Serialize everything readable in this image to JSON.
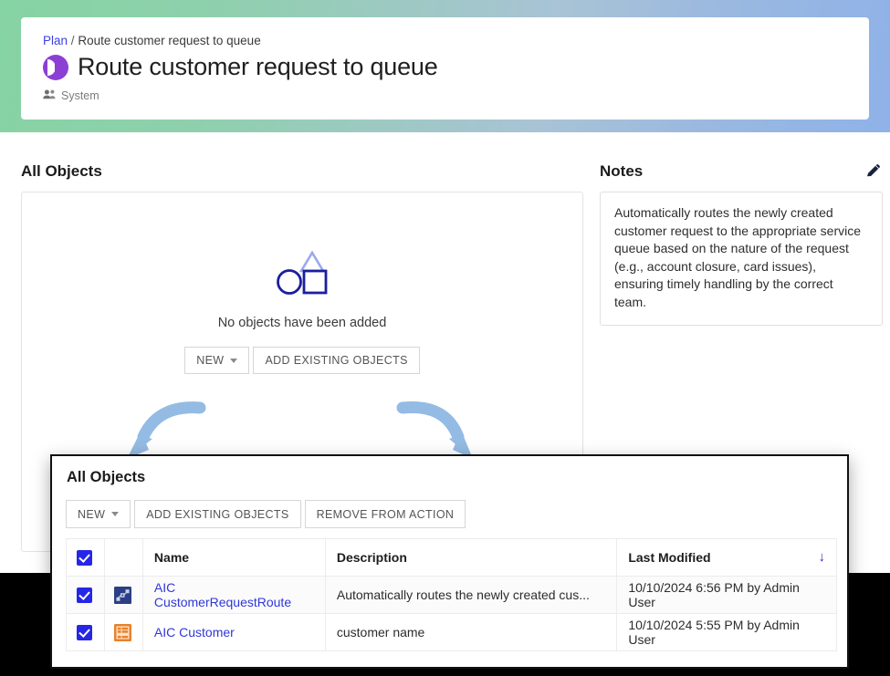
{
  "banner": {
    "breadcrumb": {
      "root_label": "Plan",
      "separator": "/",
      "current_label": "Route customer request to queue"
    },
    "title": "Route customer request to queue",
    "title_icon": "plan-half-circle-icon",
    "owner_icon": "people-icon",
    "owner_label": "System",
    "gradient_from": "#86d3a3",
    "gradient_to": "#8fb2e8"
  },
  "objects_section": {
    "heading": "All Objects",
    "empty_state": {
      "icon": "shapes-icon",
      "message": "No objects have been added",
      "new_button": "NEW",
      "add_existing_button": "ADD EXISTING OBJECTS"
    }
  },
  "notes_section": {
    "heading": "Notes",
    "edit_icon": "pencil-icon",
    "body": "Automatically routes the newly created customer request to the appropriate service queue based on the nature of the request (e.g., account closure, card issues), ensuring timely handling by the correct team."
  },
  "popup": {
    "title": "All Objects",
    "toolbar": {
      "new_button": "NEW",
      "add_existing_button": "ADD EXISTING OBJECTS",
      "remove_button": "REMOVE FROM ACTION"
    },
    "table": {
      "headers": {
        "select_all": true,
        "icon": "",
        "name": "Name",
        "description": "Description",
        "last_modified": "Last Modified",
        "sort_indicator": "↓"
      },
      "rows": [
        {
          "checked": true,
          "icon": "interface-flow-icon",
          "icon_color": "#2b3f87",
          "name": "AIC CustomerRequestRoute",
          "description": "Automatically routes the newly created cus...",
          "last_modified": "10/10/2024 6:56 PM by Admin User"
        },
        {
          "checked": true,
          "icon": "record-type-table-icon",
          "icon_color": "#e8812b",
          "name": "AIC Customer",
          "description": "customer name",
          "last_modified": "10/10/2024 5:55 PM by Admin User"
        }
      ]
    }
  },
  "annotations": {
    "arrow_color": "#94bbe4",
    "left_arrow": "curved-arrow-down-left",
    "right_arrow": "curved-arrow-down-right"
  },
  "colors": {
    "link": "#2f37d8",
    "checkbox": "#2626e6",
    "plan_icon": "#8b3fd4"
  }
}
